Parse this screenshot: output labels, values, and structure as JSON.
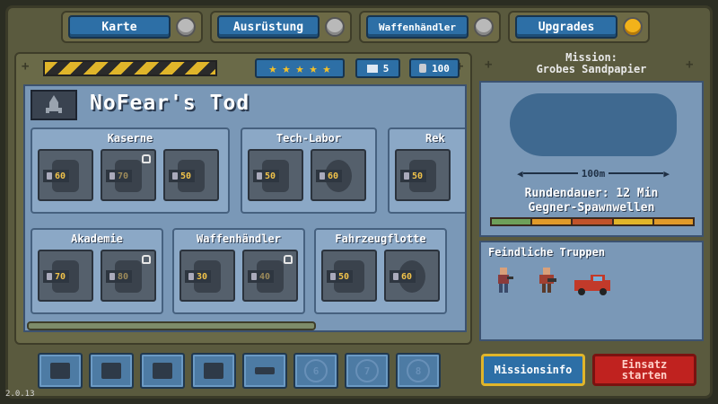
{
  "tabs": [
    {
      "label": "Karte",
      "active": false
    },
    {
      "label": "Ausrüstung",
      "active": false
    },
    {
      "label": "Waffenhändler",
      "active": false
    },
    {
      "label": "Upgrades",
      "active": true
    }
  ],
  "header": {
    "stars": 5,
    "tickets": "5",
    "coins": "100"
  },
  "main": {
    "title": "NoFear's Tod",
    "groups": [
      {
        "name": "Kaserne",
        "units": [
          {
            "cost": "60",
            "locked": false
          },
          {
            "cost": "70",
            "locked": true
          },
          {
            "cost": "50",
            "locked": false
          }
        ]
      },
      {
        "name": "Tech-Labor",
        "units": [
          {
            "cost": "50",
            "locked": false
          },
          {
            "cost": "60",
            "locked": false
          }
        ]
      },
      {
        "name": "Rek",
        "units": [
          {
            "cost": "50",
            "locked": false
          }
        ]
      },
      {
        "name": "Akademie",
        "units": [
          {
            "cost": "70",
            "locked": false
          },
          {
            "cost": "80",
            "locked": true
          }
        ]
      },
      {
        "name": "Waffenhändler",
        "units": [
          {
            "cost": "30",
            "locked": false
          },
          {
            "cost": "40",
            "locked": true
          }
        ]
      },
      {
        "name": "Fahrzeugflotte",
        "units": [
          {
            "cost": "50",
            "locked": false
          },
          {
            "cost": "60",
            "locked": false
          }
        ]
      }
    ]
  },
  "mission": {
    "label": "Mission:",
    "name": "Grobes Sandpapier",
    "distance": "100m",
    "duration": "Rundendauer: 12 Min",
    "waves": "Gegner-Spawnwellen",
    "enemies_title": "Feindliche Truppen"
  },
  "slots": [
    {
      "type": "unit"
    },
    {
      "type": "unit"
    },
    {
      "type": "unit"
    },
    {
      "type": "unit"
    },
    {
      "type": "unit"
    },
    {
      "type": "number",
      "label": "6"
    },
    {
      "type": "number",
      "label": "7"
    },
    {
      "type": "number",
      "label": "8"
    }
  ],
  "buttons": {
    "info": "Missionsinfo",
    "start_line1": "Einsatz",
    "start_line2": "starten"
  },
  "version": "2.0.13",
  "colors": {
    "button_blue": "#2d6fa6",
    "start_red": "#c0221f",
    "hazard_yellow": "#e0b52a",
    "coin_gold": "#f0c24a"
  }
}
